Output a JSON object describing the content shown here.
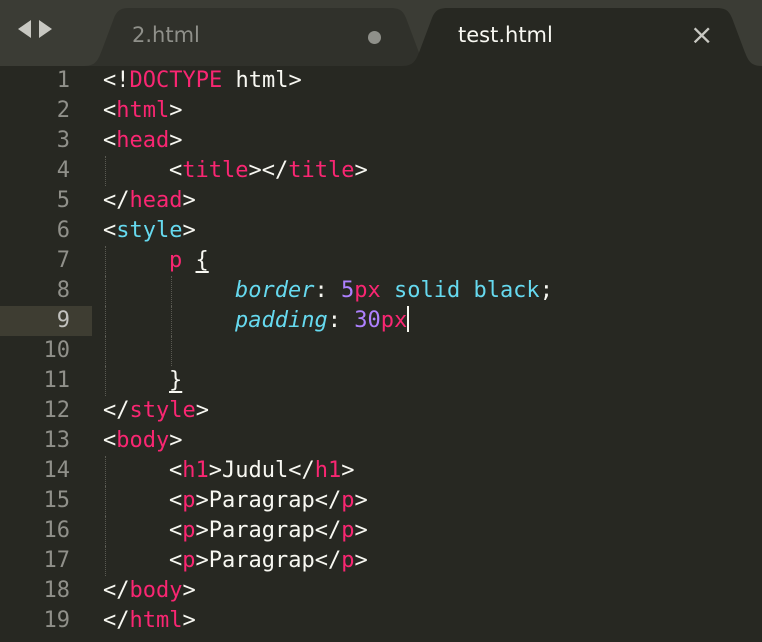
{
  "tabs": [
    {
      "label": "2.html",
      "active": false,
      "modified": true
    },
    {
      "label": "test.html",
      "active": true,
      "close_glyph": "×"
    }
  ],
  "editor": {
    "current_line": 9,
    "lines": [
      {
        "n": "1",
        "t": [
          "<!",
          "DOCTYPE",
          " html>"
        ]
      },
      {
        "n": "2",
        "t": [
          "<",
          "html",
          ">"
        ]
      },
      {
        "n": "3",
        "t": [
          "<",
          "head",
          ">"
        ]
      },
      {
        "n": "4",
        "t": [
          "<",
          "title",
          "></",
          "title",
          ">"
        ]
      },
      {
        "n": "5",
        "t": [
          "</",
          "head",
          ">"
        ]
      },
      {
        "n": "6",
        "t": [
          "<",
          "style",
          ">"
        ]
      },
      {
        "n": "7",
        "t": [
          "p",
          " ",
          "{"
        ]
      },
      {
        "n": "8",
        "t": [
          "border",
          ": ",
          "5",
          "px",
          " solid black",
          ";"
        ]
      },
      {
        "n": "9",
        "t": [
          "padding",
          ": ",
          "30",
          "px"
        ]
      },
      {
        "n": "10",
        "t": []
      },
      {
        "n": "11",
        "t": [
          "}"
        ]
      },
      {
        "n": "12",
        "t": [
          "</",
          "style",
          ">"
        ]
      },
      {
        "n": "13",
        "t": [
          "<",
          "body",
          ">"
        ]
      },
      {
        "n": "14",
        "t": [
          "<",
          "h1",
          ">Judul</",
          "h1",
          ">"
        ]
      },
      {
        "n": "15",
        "t": [
          "<",
          "p",
          ">Paragrap</",
          "p",
          ">"
        ]
      },
      {
        "n": "16",
        "t": [
          "<",
          "p",
          ">Paragrap</",
          "p",
          ">"
        ]
      },
      {
        "n": "17",
        "t": [
          "<",
          "p",
          ">Paragrap</",
          "p",
          ">"
        ]
      },
      {
        "n": "18",
        "t": [
          "</",
          "body",
          ">"
        ]
      },
      {
        "n": "19",
        "t": [
          "</",
          "html",
          ">"
        ]
      }
    ]
  },
  "colors": {
    "background": "#272822",
    "tag": "#f92672",
    "property": "#66d9ef",
    "number": "#ae81ff",
    "text": "#f8f8f2",
    "gutter": "#90908a"
  },
  "icons": {
    "nav_back": "back-arrow-icon",
    "nav_forward": "forward-arrow-icon",
    "modified": "unsaved-dot-icon",
    "close": "close-icon"
  }
}
